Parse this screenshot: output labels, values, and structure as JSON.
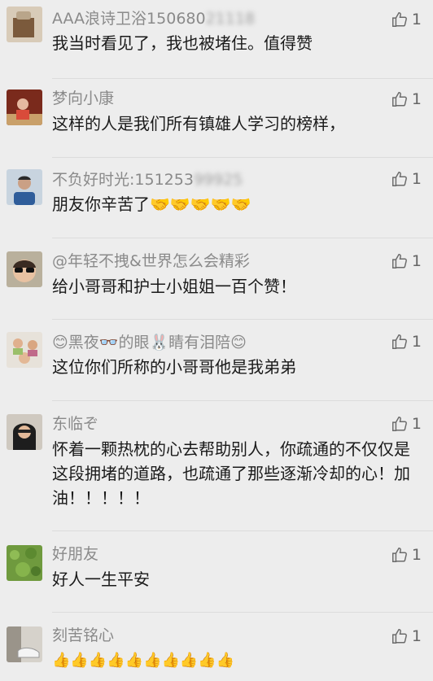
{
  "comments": [
    {
      "name": "AAA浪诗卫浴150680",
      "name_blurred": "21118",
      "text": "我当时看见了，我也被堵住。值得赞",
      "likes": "1"
    },
    {
      "name": "梦向小康",
      "name_blurred": "",
      "text": "这样的人是我们所有镇雄人学习的榜样，",
      "likes": "1"
    },
    {
      "name": "不负好时光:151253",
      "name_blurred": "99925",
      "text": "朋友你辛苦了🤝🤝🤝🤝🤝",
      "likes": "1"
    },
    {
      "name": "@年轻不拽&世界怎么会精彩",
      "name_blurred": "",
      "text": "给小哥哥和护士小姐姐一百个赞！",
      "likes": "1"
    },
    {
      "name": "😊黑夜👓的眼🐰睛有泪陪😊",
      "name_blurred": "",
      "text": "这位你们所称的小哥哥他是我弟弟",
      "likes": "1"
    },
    {
      "name": "东临ぞ",
      "name_blurred": "",
      "text": "怀着一颗热枕的心去帮助别人，你疏通的不仅仅是这段拥堵的道路，也疏通了那些逐渐冷却的心！加油！！！！！",
      "likes": "1"
    },
    {
      "name": "好朋友",
      "name_blurred": "",
      "text": "好人一生平安",
      "likes": "1"
    },
    {
      "name": "刻苦铭心",
      "name_blurred": "",
      "text": "👍👍👍👍👍👍👍👍👍👍",
      "likes": "1"
    }
  ]
}
